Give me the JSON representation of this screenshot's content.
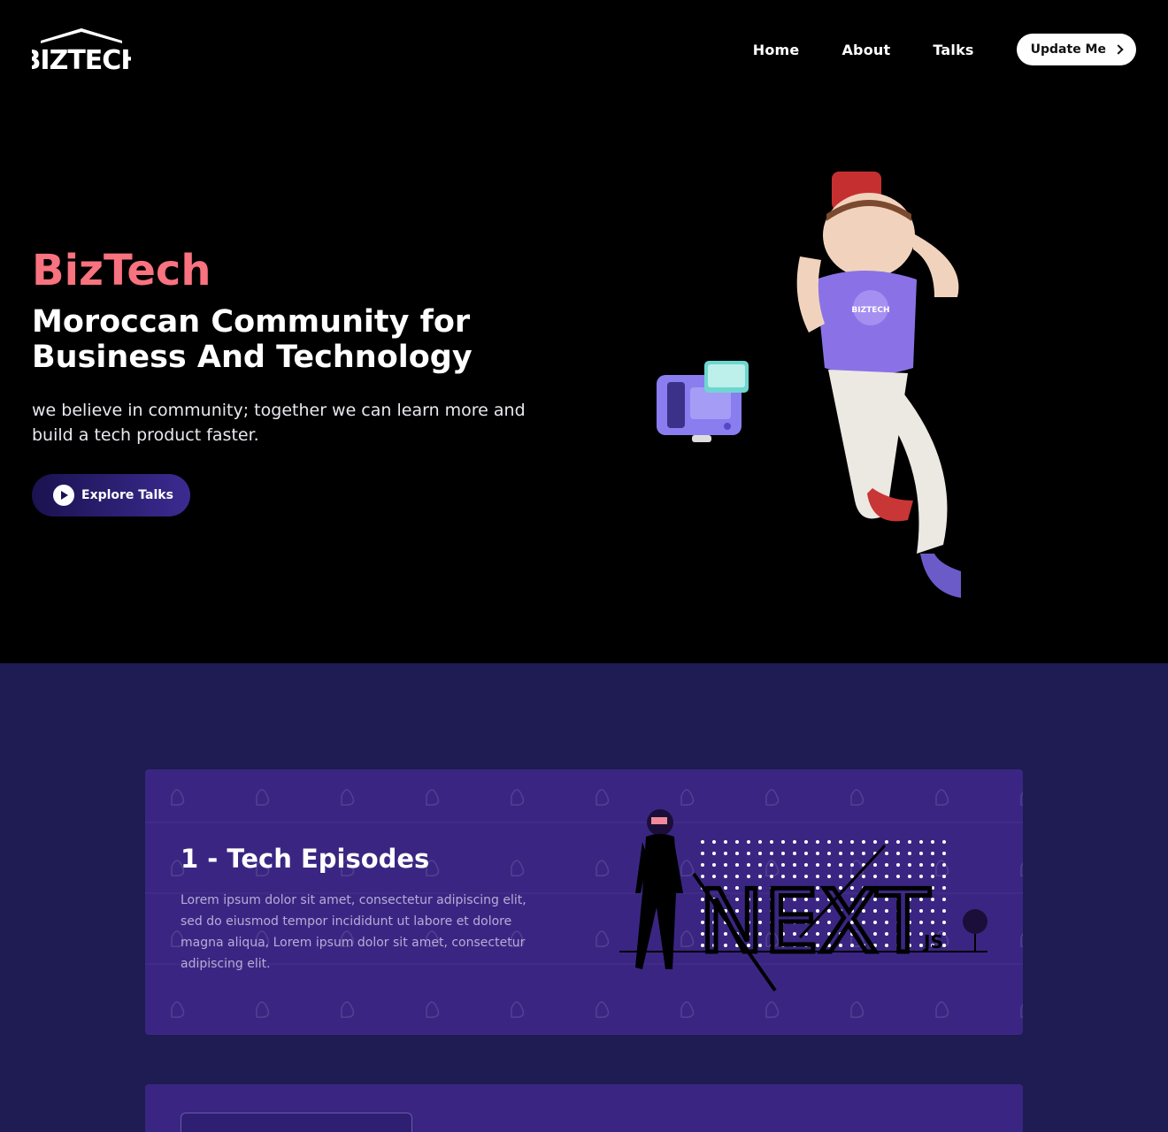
{
  "nav": {
    "logo_text": "BIZTECH",
    "links": [
      "Home",
      "About",
      "Talks"
    ],
    "cta_label": "Update Me"
  },
  "hero": {
    "title": "BizTech",
    "subtitle": "Moroccan Community for Business And Technology",
    "description": "we believe in community; together we can learn more and build a tech product faster.",
    "button_label": "Explore Talks",
    "mascot_shirt_text": "BIZTECH"
  },
  "episodes": [
    {
      "title": "1 - Tech Episodes",
      "description": "Lorem ipsum dolor sit amet, consectetur adipiscing elit, sed do eiusmod tempor incididunt ut labore et dolore magna aliqua, Lorem ipsum dolor sit amet, consectetur adipiscing elit.",
      "illustration_text": "NEXT",
      "illustration_subtext": "JS"
    }
  ],
  "colors": {
    "accent": "#f8727f",
    "section_bg": "#1e1c52",
    "card_bg": "#3a2682",
    "button_gradient_start": "#1a1250",
    "button_gradient_end": "#3b2b91"
  }
}
